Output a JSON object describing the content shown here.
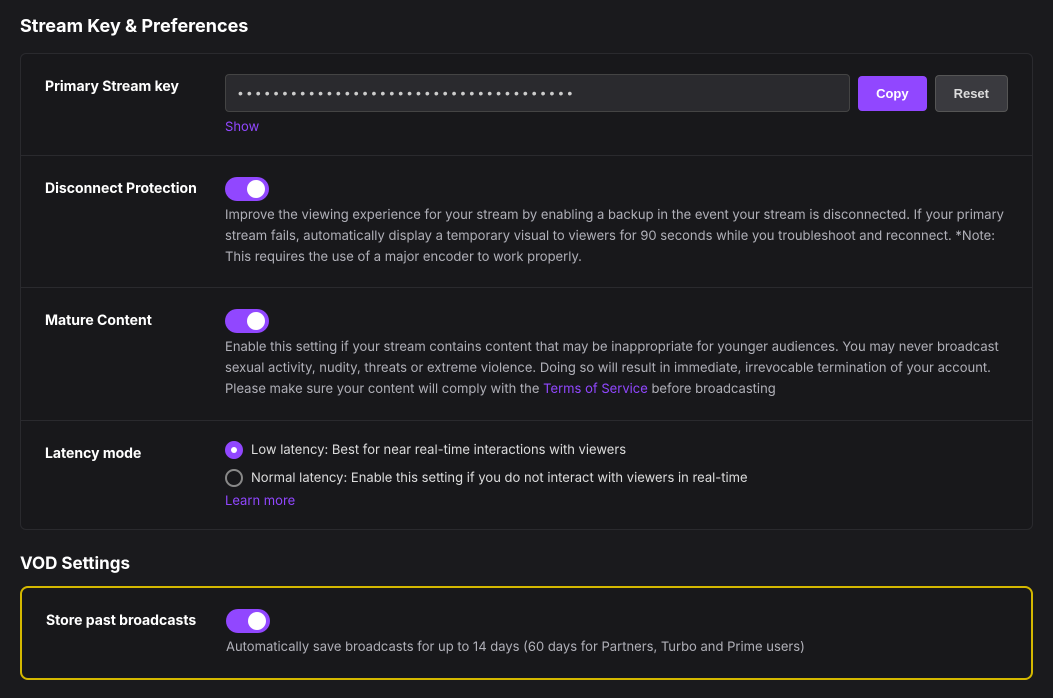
{
  "page": {
    "title": "Stream Key & Preferences",
    "vod_title": "VOD Settings"
  },
  "stream_key": {
    "label": "Primary Stream key",
    "placeholder": "••••••••••••••••••••••••••••••••••••••",
    "copy_button": "Copy",
    "reset_button": "Reset",
    "show_link": "Show"
  },
  "disconnect_protection": {
    "label": "Disconnect Protection",
    "enabled": true,
    "description": "Improve the viewing experience for your stream by enabling a backup in the event your stream is disconnected. If your primary stream fails, automatically display a temporary visual to viewers for 90 seconds while you troubleshoot and reconnect. *Note: This requires the use of a major encoder to work properly."
  },
  "mature_content": {
    "label": "Mature Content",
    "enabled": true,
    "description_before": "Enable this setting if your stream contains content that may be inappropriate for younger audiences. You may never broadcast sexual activity, nudity, threats or extreme violence. Doing so will result in immediate, irrevocable termination of your account. Please make sure your content will comply with the ",
    "tos_link_text": "Terms of Service",
    "description_after": " before broadcasting"
  },
  "latency_mode": {
    "label": "Latency mode",
    "options": [
      {
        "id": "low",
        "label": "Low latency: Best for near real-time interactions with viewers",
        "selected": true
      },
      {
        "id": "normal",
        "label": "Normal latency: Enable this setting if you do not interact with viewers in real-time",
        "selected": false
      }
    ],
    "learn_more": "Learn more"
  },
  "store_past_broadcasts": {
    "label": "Store past broadcasts",
    "enabled": true,
    "description": "Automatically save broadcasts for up to 14 days (60 days for Partners, Turbo and Prime users)"
  }
}
